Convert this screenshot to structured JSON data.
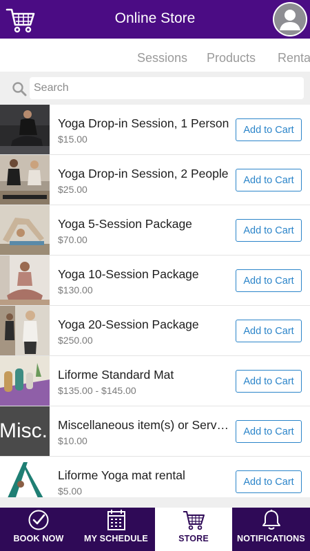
{
  "header": {
    "title": "Online Store",
    "logo_icon": "shopping-cart-icon",
    "avatar_icon": "user-avatar-icon"
  },
  "colors": {
    "brand_purple": "#4b0c84",
    "nav_dark": "#2f0a57",
    "button_blue": "#2a84c9"
  },
  "tabs": [
    {
      "label": "Sessions"
    },
    {
      "label": "Products"
    },
    {
      "label": "Rentals"
    }
  ],
  "search": {
    "placeholder": "Search",
    "value": ""
  },
  "products": [
    {
      "name": "Yoga Drop-in Session, 1 Person",
      "price": "$15.00",
      "button": "Add to Cart"
    },
    {
      "name": "Yoga Drop-in Session, 2 People",
      "price": "$25.00",
      "button": "Add to Cart"
    },
    {
      "name": "Yoga 5-Session Package",
      "price": "$70.00",
      "button": "Add to Cart"
    },
    {
      "name": "Yoga 10-Session Package",
      "price": "$130.00",
      "button": "Add to Cart"
    },
    {
      "name": "Yoga 20-Session Package",
      "price": "$250.00",
      "button": "Add to Cart"
    },
    {
      "name": "Liforme Standard Mat",
      "price": "$135.00 - $145.00",
      "button": "Add to Cart"
    },
    {
      "name": "Miscellaneous item(s) or Services",
      "price": "$10.00",
      "button": "Add to Cart",
      "thumb_text": "Misc."
    },
    {
      "name": "Liforme Yoga mat rental",
      "price": "$5.00",
      "button": "Add to Cart"
    }
  ],
  "bottom_nav": [
    {
      "label": "BOOK NOW",
      "icon": "check-circle-icon",
      "active": false
    },
    {
      "label": "MY SCHEDULE",
      "icon": "calendar-icon",
      "active": false
    },
    {
      "label": "STORE",
      "icon": "cart-icon",
      "active": true
    },
    {
      "label": "NOTIFICATIONS",
      "icon": "bell-icon",
      "active": false
    }
  ]
}
